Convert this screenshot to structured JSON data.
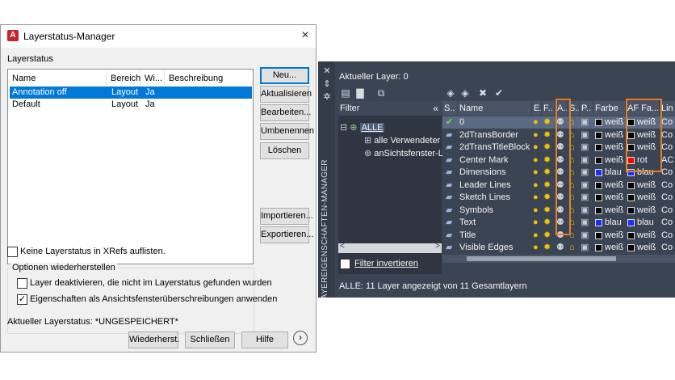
{
  "dialog": {
    "title": "Layerstatus-Manager",
    "close": "×",
    "group_label": "Layerstatus",
    "columns": [
      "Name",
      "Bereich",
      "Wi...",
      "Beschreibung"
    ],
    "rows": [
      {
        "name": "Annotation off",
        "bereich": "Layout",
        "wi": "Ja",
        "beschreibung": ""
      },
      {
        "name": "Default",
        "bereich": "Layout",
        "wi": "Ja",
        "beschreibung": ""
      }
    ],
    "buttons": {
      "neu": "Neu...",
      "aktualisieren": "Aktualisieren",
      "bearbeiten": "Bearbeiten...",
      "umbenennen": "Umbenennen",
      "loeschen": "Löschen",
      "importieren": "Importieren...",
      "exportieren": "Exportieren..."
    },
    "xrefs_checkbox": "Keine Layerstatus in XRefs auflisten.",
    "options_title": "Optionen wiederherstellen",
    "option1": "Layer deaktivieren, die nicht im Layerstatus gefunden wurden",
    "option2": "Eigenschaften als Ansichtsfensterüberschreibungen anwenden",
    "current_state": "Aktueller Layerstatus: *UNGESPEICHERT*",
    "footer": {
      "wiederherst": "Wiederherst.",
      "schliessen": "Schließen",
      "hilfe": "Hilfe",
      "more": "›"
    }
  },
  "palette": {
    "side_title": "LAYEREIGENSCHAFTEN-MANAGER",
    "current_layer": "Aktueller Layer: 0",
    "filter": {
      "header": "Filter",
      "collapse": "«",
      "tree": [
        "ALLE",
        "alle Verwendeter",
        "anSichtsfenster-L"
      ],
      "invert": "Filter invertieren"
    },
    "columns": [
      "S..",
      "Name",
      "E..",
      "F..",
      "A..",
      "S..",
      "P..",
      "Farbe",
      "AF Fa...",
      "Lin"
    ],
    "layers": [
      {
        "name": "0",
        "farbe": "weiß",
        "af": "weiß",
        "lin": "Co",
        "color": "#000000",
        "af_color": "#000000",
        "current": true
      },
      {
        "name": "2dTransBorder",
        "farbe": "weiß",
        "af": "weiß",
        "lin": "Co",
        "color": "#000000",
        "af_color": "#000000"
      },
      {
        "name": "2dTransTitleBlock",
        "farbe": "weiß",
        "af": "weiß",
        "lin": "Co",
        "color": "#000000",
        "af_color": "#000000"
      },
      {
        "name": "Center Mark",
        "farbe": "weiß",
        "af": "rot",
        "lin": "AC",
        "color": "#000000",
        "af_color": "#ff0000"
      },
      {
        "name": "Dimensions",
        "farbe": "blau",
        "af": "blau",
        "lin": "Co",
        "color": "#1a2cff",
        "af_color": "#1a2cff"
      },
      {
        "name": "Leader Lines",
        "farbe": "weiß",
        "af": "weiß",
        "lin": "Co",
        "color": "#000000",
        "af_color": "#000000"
      },
      {
        "name": "Sketch Lines",
        "farbe": "weiß",
        "af": "weiß",
        "lin": "Co",
        "color": "#000000",
        "af_color": "#000000"
      },
      {
        "name": "Symbols",
        "farbe": "weiß",
        "af": "weiß",
        "lin": "Co",
        "color": "#000000",
        "af_color": "#000000"
      },
      {
        "name": "Text",
        "farbe": "blau",
        "af": "blau",
        "lin": "Co",
        "color": "#1a2cff",
        "af_color": "#1a2cff"
      },
      {
        "name": "Title",
        "farbe": "weiß",
        "af": "weiß",
        "lin": "Co",
        "color": "#000000",
        "af_color": "#000000"
      },
      {
        "name": "Visible Edges",
        "farbe": "weiß",
        "af": "weiß",
        "lin": "Co",
        "color": "#000000",
        "af_color": "#000000"
      }
    ],
    "status": "ALLE: 11 Layer angezeigt von 11 Gesamtlayern",
    "accent_highlight": "#e67e22"
  }
}
